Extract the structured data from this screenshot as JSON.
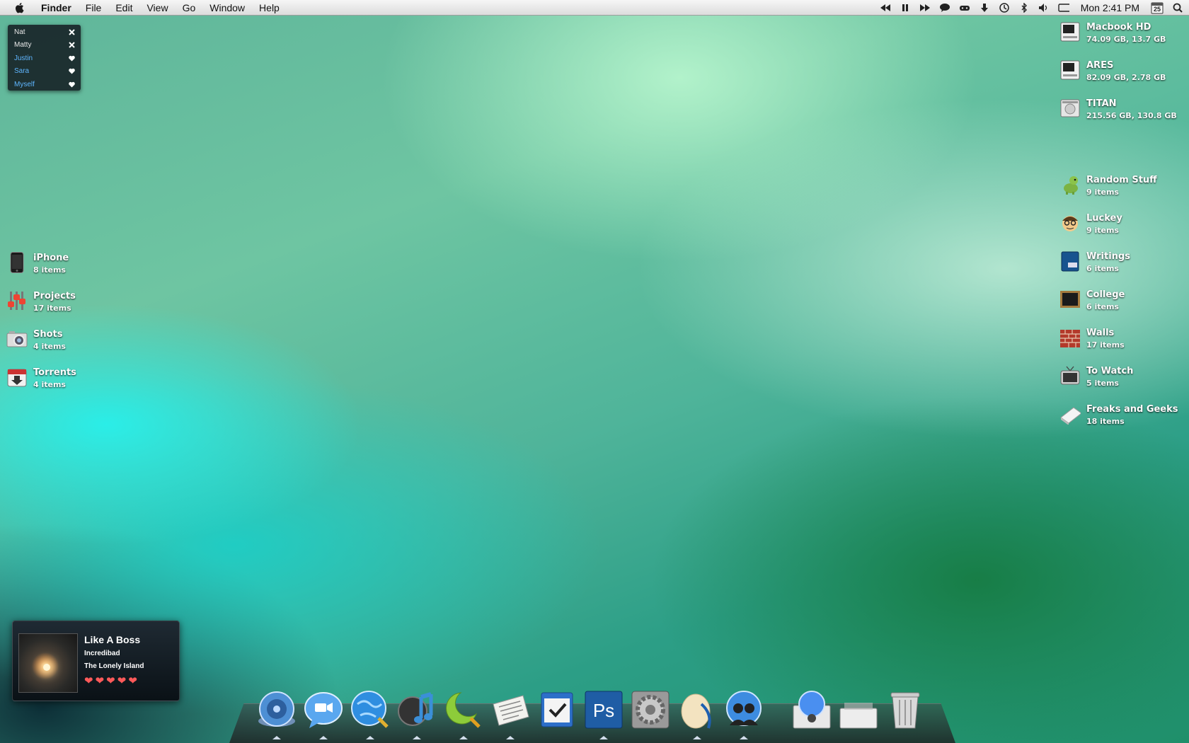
{
  "menubar": {
    "app_name": "Finder",
    "menus": [
      "File",
      "Edit",
      "View",
      "Go",
      "Window",
      "Help"
    ],
    "clock": "Mon 2:41 PM",
    "calendar_day": "25"
  },
  "contacts": [
    {
      "name": "Nat",
      "action": "close"
    },
    {
      "name": "Matty",
      "action": "close"
    },
    {
      "name": "Justin",
      "action": "heart"
    },
    {
      "name": "Sara",
      "action": "heart"
    },
    {
      "name": "Myself",
      "action": "heart"
    }
  ],
  "left_items": [
    {
      "title": "iPhone",
      "sub": "8 items",
      "icon": "iphone-icon"
    },
    {
      "title": "Projects",
      "sub": "17 items",
      "icon": "projects-icon"
    },
    {
      "title": "Shots",
      "sub": "4 items",
      "icon": "camera-icon"
    },
    {
      "title": "Torrents",
      "sub": "4 items",
      "icon": "torrents-icon"
    }
  ],
  "right_items": [
    {
      "title": "Macbook HD",
      "sub": "74.09 GB, 13.7 GB",
      "icon": "hard-drive-icon"
    },
    {
      "title": "ARES",
      "sub": "82.09 GB, 2.78 GB",
      "icon": "hard-drive-icon"
    },
    {
      "title": "TITAN",
      "sub": "215.56 GB, 130.8 GB",
      "icon": "external-drive-icon"
    },
    {
      "title": "Random Stuff",
      "sub": "9 items",
      "icon": "dinosaur-icon"
    },
    {
      "title": "Luckey",
      "sub": "9 items",
      "icon": "face-icon"
    },
    {
      "title": "Writings",
      "sub": "6 items",
      "icon": "notebook-icon"
    },
    {
      "title": "College",
      "sub": "6 items",
      "icon": "chalkboard-icon"
    },
    {
      "title": "Walls",
      "sub": "17 items",
      "icon": "brick-wall-icon"
    },
    {
      "title": "To Watch",
      "sub": "5 items",
      "icon": "tv-icon"
    },
    {
      "title": "Freaks and Geeks",
      "sub": "18 items",
      "icon": "book-icon"
    }
  ],
  "now_playing": {
    "title": "Like A Boss",
    "album": "Incredibad",
    "artist": "The Lonely Island",
    "rating": 5
  },
  "dock": [
    "finder-icon",
    "ichat-icon",
    "web-browser-icon",
    "itunes-icon",
    "moon-search-icon",
    "newsreader-icon",
    "tasks-icon",
    "photoshop-icon",
    "system-preferences-icon",
    "quill-egg-icon",
    "people-globe-icon"
  ],
  "dock_right": [
    "download-stack-icon",
    "documents-stack-icon",
    "trash-icon"
  ],
  "colors": {
    "menubar_bg": "#e8e8e8",
    "contact_blue": "#5fb6ff",
    "heart_red": "#ff5a5a"
  }
}
